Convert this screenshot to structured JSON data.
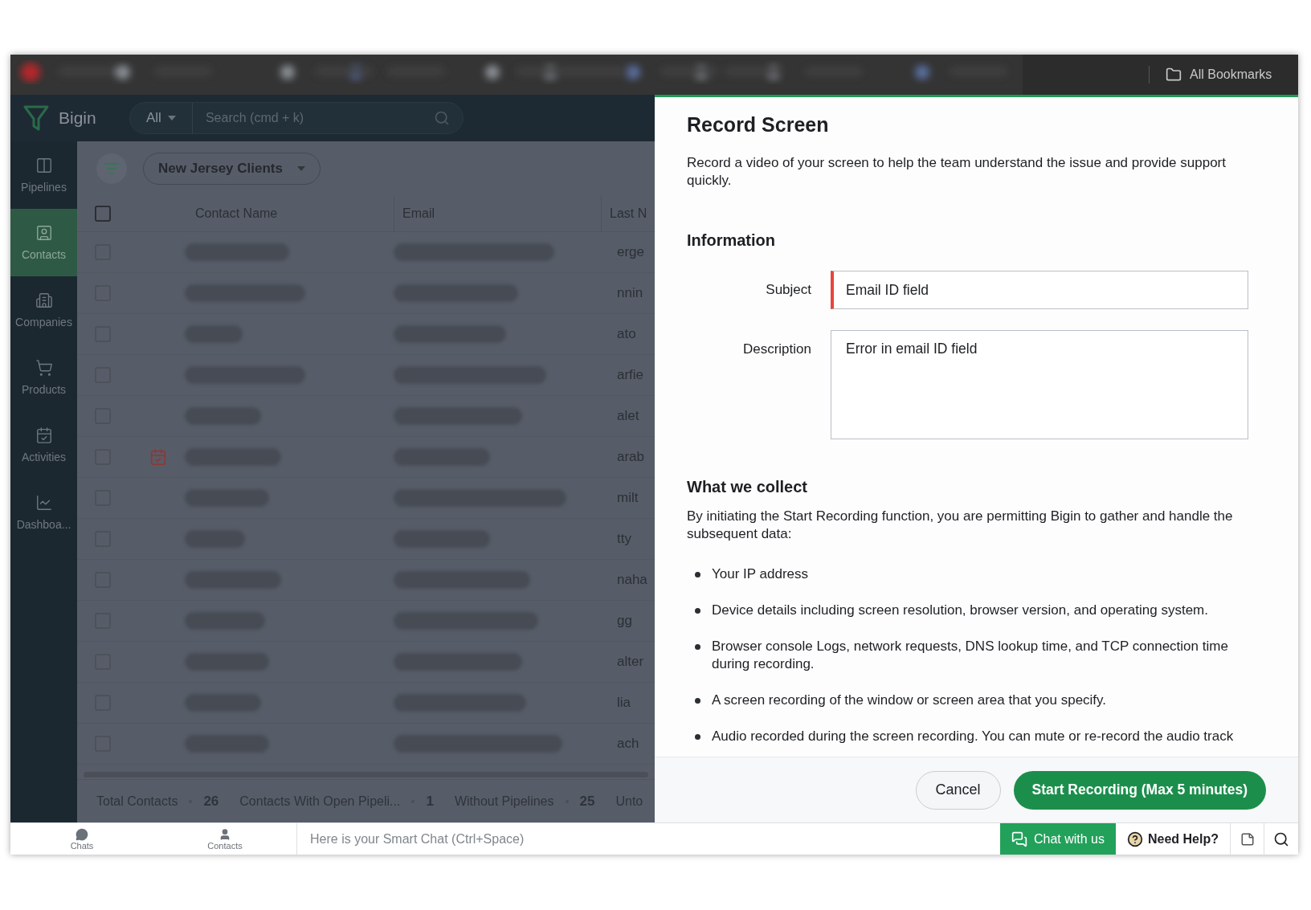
{
  "browser": {
    "bookmarks_label": "All Bookmarks"
  },
  "app": {
    "name": "Bigin",
    "search_scope": "All",
    "search_placeholder": "Search (cmd + k)"
  },
  "sidebar": {
    "items": [
      {
        "label": "Pipelines",
        "kind": "pipelines",
        "selected": false
      },
      {
        "label": "Contacts",
        "kind": "contacts",
        "selected": true
      },
      {
        "label": "Companies",
        "kind": "companies",
        "selected": false
      },
      {
        "label": "Products",
        "kind": "products",
        "selected": false
      },
      {
        "label": "Activities",
        "kind": "activities",
        "selected": false
      },
      {
        "label": "Dashboa...",
        "kind": "dashboards",
        "selected": false
      }
    ]
  },
  "view": {
    "name": "New Jersey Clients"
  },
  "table": {
    "header_checked": false,
    "columns": [
      "Contact Name",
      "Email",
      "Last N"
    ],
    "rows": [
      {
        "checked": false,
        "has_activity": false,
        "column_3": "erge"
      },
      {
        "checked": false,
        "has_activity": false,
        "column_3": "nnin"
      },
      {
        "checked": false,
        "has_activity": false,
        "column_3": "ato"
      },
      {
        "checked": false,
        "has_activity": false,
        "column_3": "arfie"
      },
      {
        "checked": false,
        "has_activity": false,
        "column_3": "alet"
      },
      {
        "checked": false,
        "has_activity": true,
        "column_3": "arab"
      },
      {
        "checked": false,
        "has_activity": false,
        "column_3": "milt"
      },
      {
        "checked": false,
        "has_activity": false,
        "column_3": "tty"
      },
      {
        "checked": false,
        "has_activity": false,
        "column_3": "naha"
      },
      {
        "checked": false,
        "has_activity": false,
        "column_3": "gg"
      },
      {
        "checked": false,
        "has_activity": false,
        "column_3": "alter"
      },
      {
        "checked": false,
        "has_activity": false,
        "column_3": "lia"
      },
      {
        "checked": false,
        "has_activity": false,
        "column_3": "ach"
      }
    ]
  },
  "summary": [
    {
      "label": "Total Contacts",
      "count": "26"
    },
    {
      "label": "Contacts With Open Pipeli...",
      "count": "1"
    },
    {
      "label": "Without Pipelines",
      "count": "25"
    },
    {
      "label": "Unto"
    }
  ],
  "dialog": {
    "title": "Record Screen",
    "intro": "Record a video of your screen to help the team understand the issue and provide support quickly.",
    "info_heading": "Information",
    "fields": [
      {
        "label": "Subject",
        "value": "Email ID field",
        "kind": "input",
        "error": true
      },
      {
        "label": "Description",
        "value": "Error in email ID field",
        "kind": "textarea",
        "error": false
      }
    ],
    "collect_heading": "What we collect",
    "collect_text": "By initiating the Start Recording function, you are permitting Bigin to gather and handle the subsequent data:",
    "bullets": [
      "Your IP address",
      "Device details including screen resolution, browser version, and operating system.",
      "Browser console Logs, network requests, DNS lookup time, and TCP connection time during recording.",
      "A screen recording of the window or screen area that you specify.",
      "Audio recorded during the screen recording. You can mute or re-record the audio track"
    ],
    "cancel_button": "Cancel",
    "start_button": "Start Recording (Max 5 minutes)"
  },
  "bottom_bar": {
    "tabs": [
      {
        "label": "Chats",
        "kind": "chats"
      },
      {
        "label": "Contacts",
        "kind": "contacts"
      }
    ],
    "chat_placeholder": "Here is your Smart Chat (Ctrl+Space)",
    "chat_button": "Chat with us",
    "help_button": "Need Help?"
  }
}
